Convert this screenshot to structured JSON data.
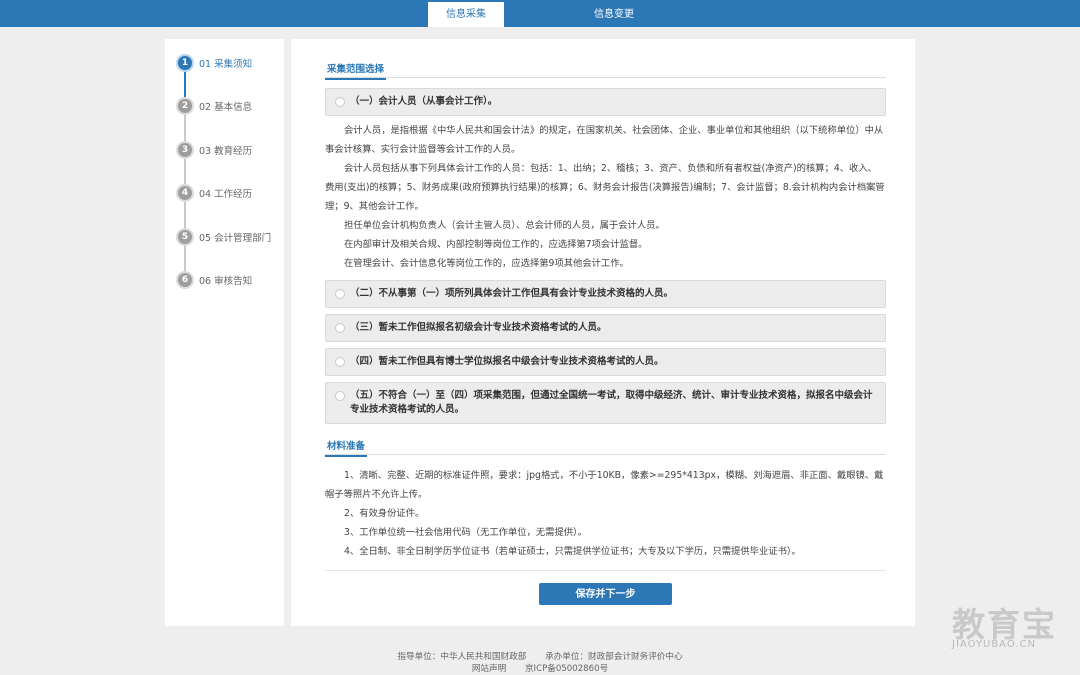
{
  "tabs": {
    "collect": "信息采集",
    "change": "信息变更"
  },
  "steps": [
    {
      "num": "1",
      "label": "01 采集须知"
    },
    {
      "num": "2",
      "label": "02 基本信息"
    },
    {
      "num": "3",
      "label": "03 教育经历"
    },
    {
      "num": "4",
      "label": "04 工作经历"
    },
    {
      "num": "5",
      "label": "05 会计管理部门"
    },
    {
      "num": "6",
      "label": "06 审核告知"
    }
  ],
  "scope": {
    "title": "采集范围选择",
    "options": [
      "（一）会计人员（从事会计工作）。",
      "（二）不从事第（一）项所列具体会计工作但具有会计专业技术资格的人员。",
      "（三）暂未工作但拟报名初级会计专业技术资格考试的人员。",
      "（四）暂未工作但具有博士学位拟报名中级会计专业技术资格考试的人员。",
      "（五）不符合（一）至（四）项采集范围，但通过全国统一考试，取得中级经济、统计、审计专业技术资格，拟报名中级会计专业技术资格考试的人员。"
    ],
    "paragraphs": [
      "会计人员，是指根据《中华人民共和国会计法》的规定，在国家机关、社会团体、企业、事业单位和其他组织（以下统称单位）中从事会计核算、实行会计监督等会计工作的人员。",
      "会计人员包括从事下列具体会计工作的人员：包括：1、出纳；2、稽核；3、资产、负债和所有者权益(净资产)的核算；4、收入、费用(支出)的核算；5、财务成果(政府预算执行结果)的核算；6、财务会计报告(决算报告)编制；7、会计监督；8.会计机构内会计档案管理；9、其他会计工作。",
      "担任单位会计机构负责人（会计主管人员）、总会计师的人员，属于会计人员。",
      "在内部审计及相关合规、内部控制等岗位工作的，应选择第7项会计监督。",
      "在管理会计、会计信息化等岗位工作的，应选择第9项其他会计工作。"
    ]
  },
  "materials": {
    "title": "材料准备",
    "items": [
      "1、清晰、完整、近期的标准证件照，要求：jpg格式，不小于10KB，像素>=295*413px，模糊、刘海遮眉、非正面、戴眼镜、戴帽子等照片不允许上传。",
      "2、有效身份证件。",
      "3、工作单位统一社会信用代码（无工作单位，无需提供）。",
      "4、全日制、非全日制学历学位证书（若单证硕士，只需提供学位证书；大专及以下学历，只需提供毕业证书）。"
    ]
  },
  "save_label": "保存并下一步",
  "footer": {
    "guide": "指导单位：中华人民共和国财政部",
    "host": "承办单位：财政部会计财务评价中心",
    "statement": "网站声明",
    "icp": "京ICP备05002860号"
  },
  "watermark": {
    "big": "教育宝",
    "small": "JIAOYUBAO.CN"
  }
}
